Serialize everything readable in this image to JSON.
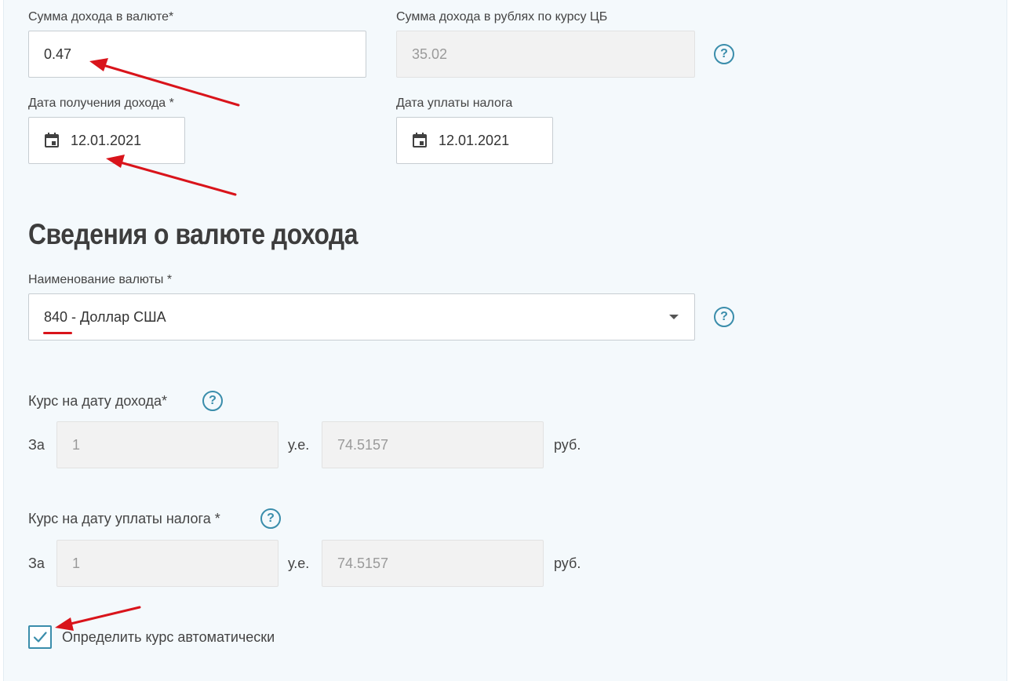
{
  "income": {
    "currency_amount_label": "Сумма дохода в валюте*",
    "currency_amount_value": "0.47",
    "rub_amount_label": "Сумма дохода в рублях по курсу ЦБ",
    "rub_amount_value": "35.02",
    "income_date_label": "Дата получения дохода *",
    "income_date_value": "12.01.2021",
    "tax_date_label": "Дата уплаты налога",
    "tax_date_value": "12.01.2021"
  },
  "currency_section": {
    "title": "Сведения о валюте дохода",
    "currency_name_label": "Наименование валюты *",
    "currency_code": "840",
    "currency_name": " - Доллар США"
  },
  "rate_income": {
    "label": "Курс на дату дохода*",
    "prefix": "За",
    "units_value": "1",
    "units_label": "у.е.",
    "rate_value": "74.5157",
    "currency_label": "руб."
  },
  "rate_tax": {
    "label": "Курс на дату уплаты налога *",
    "prefix": "За",
    "units_value": "1",
    "units_label": "у.е.",
    "rate_value": "74.5157",
    "currency_label": "руб."
  },
  "auto_rate": {
    "label": "Определить курс автоматически",
    "checked": true
  },
  "help_symbol": "?",
  "colors": {
    "accent": "#3a8dab",
    "annotation_red": "#d9141b",
    "panel_background": "#f4f9fc"
  },
  "icons": [
    "calendar-icon",
    "help-icon",
    "chevron-down-icon",
    "checkmark-icon"
  ]
}
